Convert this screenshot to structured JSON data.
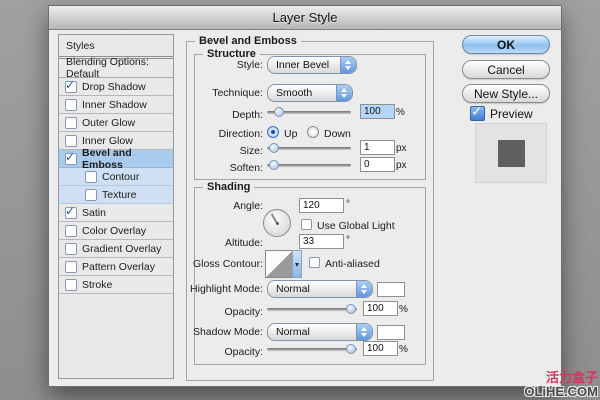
{
  "window": {
    "title": "Layer Style"
  },
  "sidebar": {
    "header": "Styles",
    "blending": "Blending Options: Default",
    "items": [
      {
        "label": "Drop Shadow",
        "checked": true,
        "indent": false,
        "selected": false
      },
      {
        "label": "Inner Shadow",
        "checked": false,
        "indent": false,
        "selected": false
      },
      {
        "label": "Outer Glow",
        "checked": false,
        "indent": false,
        "selected": false
      },
      {
        "label": "Inner Glow",
        "checked": false,
        "indent": false,
        "selected": false
      },
      {
        "label": "Bevel and Emboss",
        "checked": true,
        "indent": false,
        "selected": true
      },
      {
        "label": "Contour",
        "checked": false,
        "indent": true,
        "selected": false
      },
      {
        "label": "Texture",
        "checked": false,
        "indent": true,
        "selected": false
      },
      {
        "label": "Satin",
        "checked": true,
        "indent": false,
        "selected": false
      },
      {
        "label": "Color Overlay",
        "checked": false,
        "indent": false,
        "selected": false
      },
      {
        "label": "Gradient Overlay",
        "checked": false,
        "indent": false,
        "selected": false
      },
      {
        "label": "Pattern Overlay",
        "checked": false,
        "indent": false,
        "selected": false
      },
      {
        "label": "Stroke",
        "checked": false,
        "indent": false,
        "selected": false
      }
    ]
  },
  "panel": {
    "title": "Bevel and Emboss",
    "structure": {
      "legend": "Structure",
      "style_label": "Style:",
      "style_value": "Inner Bevel",
      "technique_label": "Technique:",
      "technique_value": "Smooth",
      "depth_label": "Depth:",
      "depth_value": "100",
      "depth_unit": "%",
      "direction_label": "Direction:",
      "direction_up": "Up",
      "direction_down": "Down",
      "direction_selected": "Up",
      "size_label": "Size:",
      "size_value": "1",
      "size_unit": "px",
      "soften_label": "Soften:",
      "soften_value": "0",
      "soften_unit": "px"
    },
    "shading": {
      "legend": "Shading",
      "angle_label": "Angle:",
      "angle_value": "120",
      "angle_unit": "°",
      "use_global_light_label": "Use Global Light",
      "use_global_light_checked": false,
      "altitude_label": "Altitude:",
      "altitude_value": "33",
      "altitude_unit": "°",
      "gloss_label": "Gloss Contour:",
      "anti_aliased_label": "Anti-aliased",
      "anti_aliased_checked": false,
      "highlight_mode_label": "Highlight Mode:",
      "highlight_mode_value": "Normal",
      "highlight_opacity_label": "Opacity:",
      "highlight_opacity_value": "100",
      "highlight_opacity_unit": "%",
      "shadow_mode_label": "Shadow Mode:",
      "shadow_mode_value": "Normal",
      "shadow_opacity_label": "Opacity:",
      "shadow_opacity_value": "100",
      "shadow_opacity_unit": "%"
    }
  },
  "actions": {
    "ok": "OK",
    "cancel": "Cancel",
    "new_style": "New Style...",
    "preview": "Preview",
    "preview_checked": true
  },
  "watermark": {
    "line1": "活力盒子",
    "line2": "OLiHE.COM",
    "accent_color": "#d6335f"
  },
  "colors": {
    "selected_row": "#a9cbee",
    "sub_row_tint": "#cfe0f4",
    "ok_button": "#8fc0f0",
    "popup_cap": "#5f97dd",
    "preview_chip": "#5f5f5f",
    "page_background": "#979797"
  }
}
